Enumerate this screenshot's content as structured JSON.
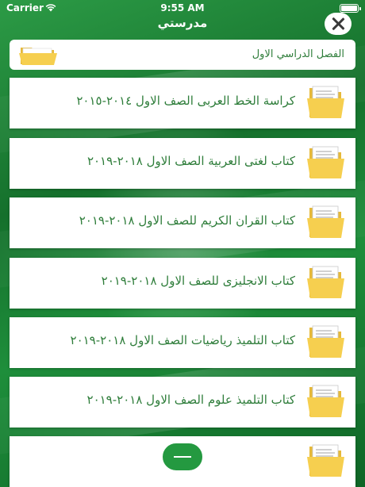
{
  "status_bar": {
    "carrier": "Carrier",
    "time": "9:55 AM"
  },
  "nav": {
    "title": "مدرستي"
  },
  "semester": {
    "label": "الفصل الدراسي الاول"
  },
  "books": [
    {
      "title": "كراسة الخط العربى الصف الاول ٢٠١٤-٢٠١٥"
    },
    {
      "title": "كتاب لغتى العربية الصف الاول ٢٠١٨-٢٠١٩"
    },
    {
      "title": "كتاب القران الكريم للصف الاول ٢٠١٨-٢٠١٩"
    },
    {
      "title": "كتاب الانجليزى للصف الاول ٢٠١٨-٢٠١٩"
    },
    {
      "title": "كتاب التلميذ رياضيات الصف الاول ٢٠١٨-٢٠١٩"
    },
    {
      "title": "كتاب التلميذ علوم الصف الاول ٢٠١٨-٢٠١٩"
    },
    {
      "title": ""
    }
  ],
  "colors": {
    "background": "#1f8a3a",
    "label_text": "#2e7d3a",
    "folder": "#f6cf4f"
  },
  "icons": {
    "close": "close-icon",
    "folder": "folder-icon",
    "document_folder": "folder-document-icon",
    "wifi": "wifi-icon",
    "battery": "battery-icon"
  }
}
